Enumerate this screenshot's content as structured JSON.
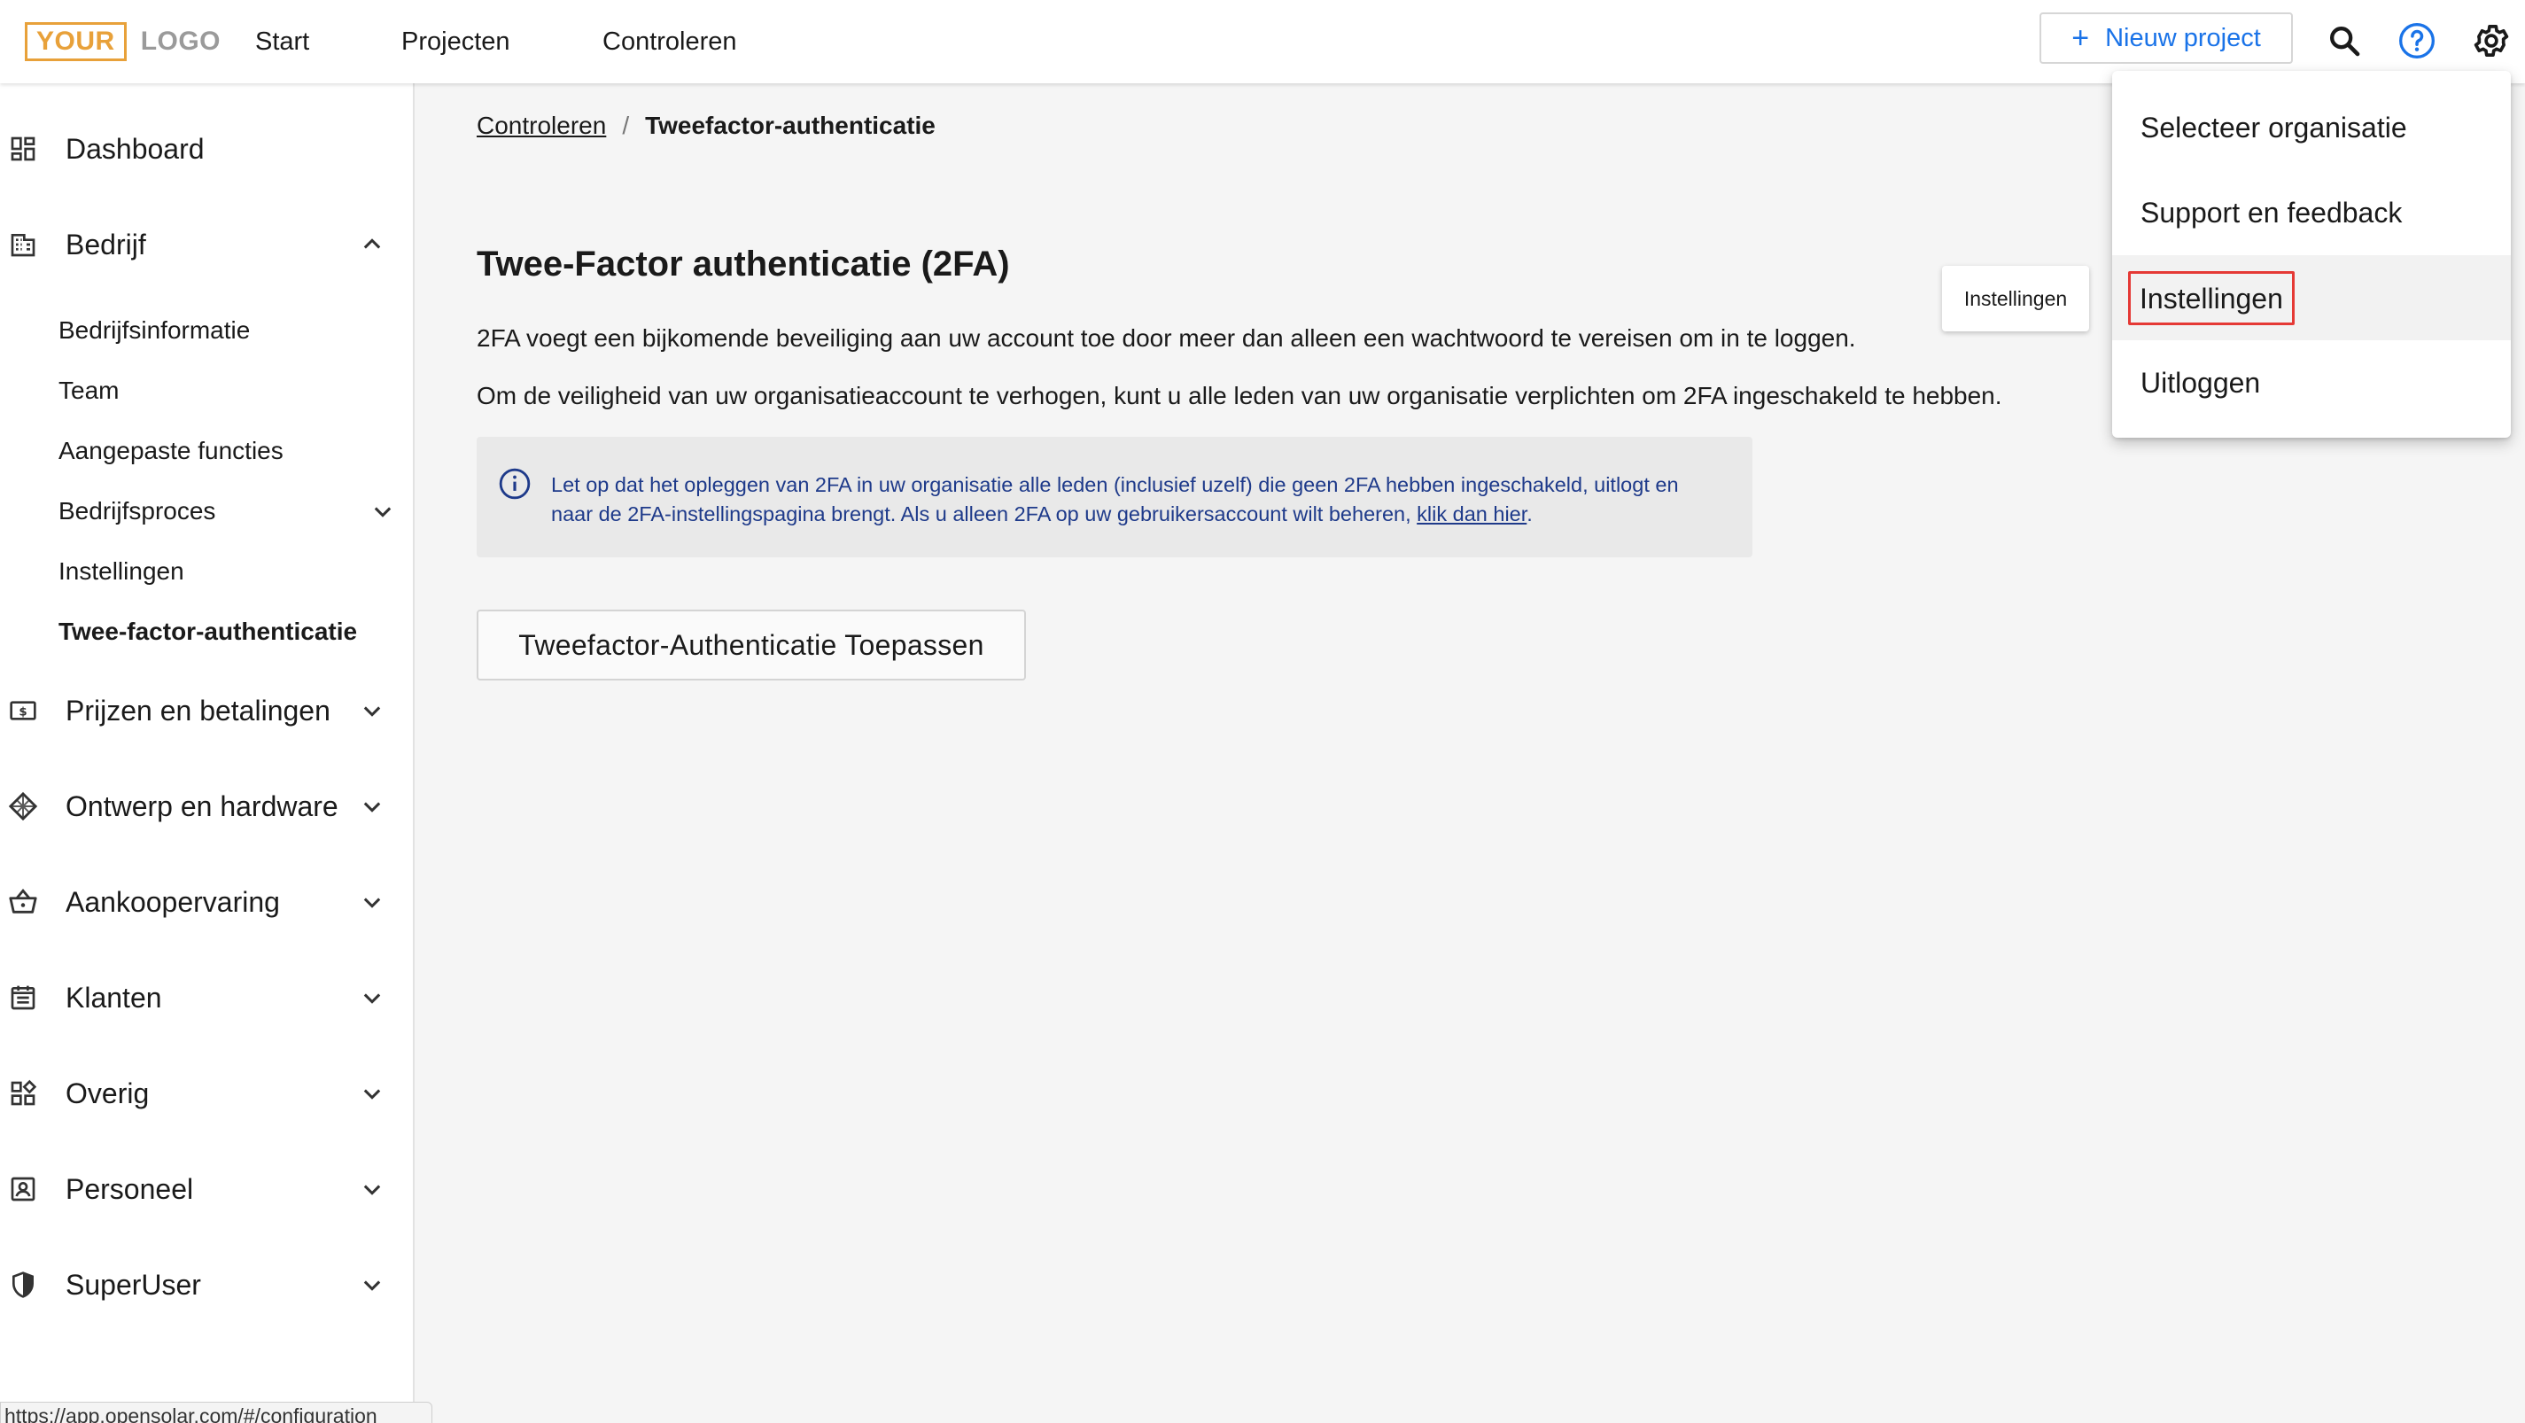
{
  "header": {
    "logo_part1": "YOUR",
    "logo_part2": "LOGO",
    "nav": [
      "Start",
      "Projecten",
      "Controleren"
    ],
    "new_project_label": "Nieuw project",
    "icons": [
      "search-icon",
      "help-icon",
      "gear-icon"
    ],
    "accent_color": "#1a73e8"
  },
  "sidebar": {
    "items": [
      {
        "label": "Dashboard",
        "icon": "dashboard-icon"
      },
      {
        "label": "Bedrijf",
        "icon": "building-icon",
        "expanded": true
      },
      {
        "label": "Prijzen en betalingen",
        "icon": "money-icon"
      },
      {
        "label": "Ontwerp en hardware",
        "icon": "grid-diamond-icon"
      },
      {
        "label": "Aankoopervaring",
        "icon": "basket-icon"
      },
      {
        "label": "Klanten",
        "icon": "list-icon"
      },
      {
        "label": "Overig",
        "icon": "widgets-icon"
      },
      {
        "label": "Personeel",
        "icon": "person-card-icon"
      },
      {
        "label": "SuperUser",
        "icon": "shield-icon"
      }
    ],
    "subitems": [
      {
        "label": "Bedrijfsinformatie"
      },
      {
        "label": "Team"
      },
      {
        "label": "Aangepaste functies"
      },
      {
        "label": "Bedrijfsproces"
      },
      {
        "label": "Instellingen"
      },
      {
        "label": "Twee-factor-authenticatie",
        "active": true
      }
    ]
  },
  "status_url": "https://app.opensolar.com/#/configuration",
  "main": {
    "breadcrumb_parent": "Controleren",
    "breadcrumb_sep": "/",
    "breadcrumb_current": "Tweefactor-authenticatie",
    "title": "Twee-Factor authenticatie (2FA)",
    "para1": "2FA voegt een bijkomende beveiliging aan uw account toe door meer dan alleen een wachtwoord te vereisen om in te loggen.",
    "para2": "Om de veiligheid van uw organisatieaccount te verhogen, kunt u alle leden van uw organisatie verplichten om 2FA ingeschakeld te hebben.",
    "info_text_line1": "Let op dat het opleggen van 2FA in uw organisatie alle leden (inclusief uzelf) die geen 2FA hebben ingeschakeld, uitlogt en",
    "info_text_line2": "naar de 2FA-instellingspagina brengt. Als u alleen 2FA op uw gebruikersaccount wilt beheren,",
    "info_link": "klik dan hier",
    "info_text_end": ".",
    "apply_button": "Tweefactor-Authenticatie Toepassen",
    "tooltip": "Instellingen"
  },
  "menu": {
    "items": [
      "Selecteer organisatie",
      "Support en feedback",
      "Instellingen",
      "Uitloggen"
    ],
    "highlight_color": "#e53935"
  }
}
